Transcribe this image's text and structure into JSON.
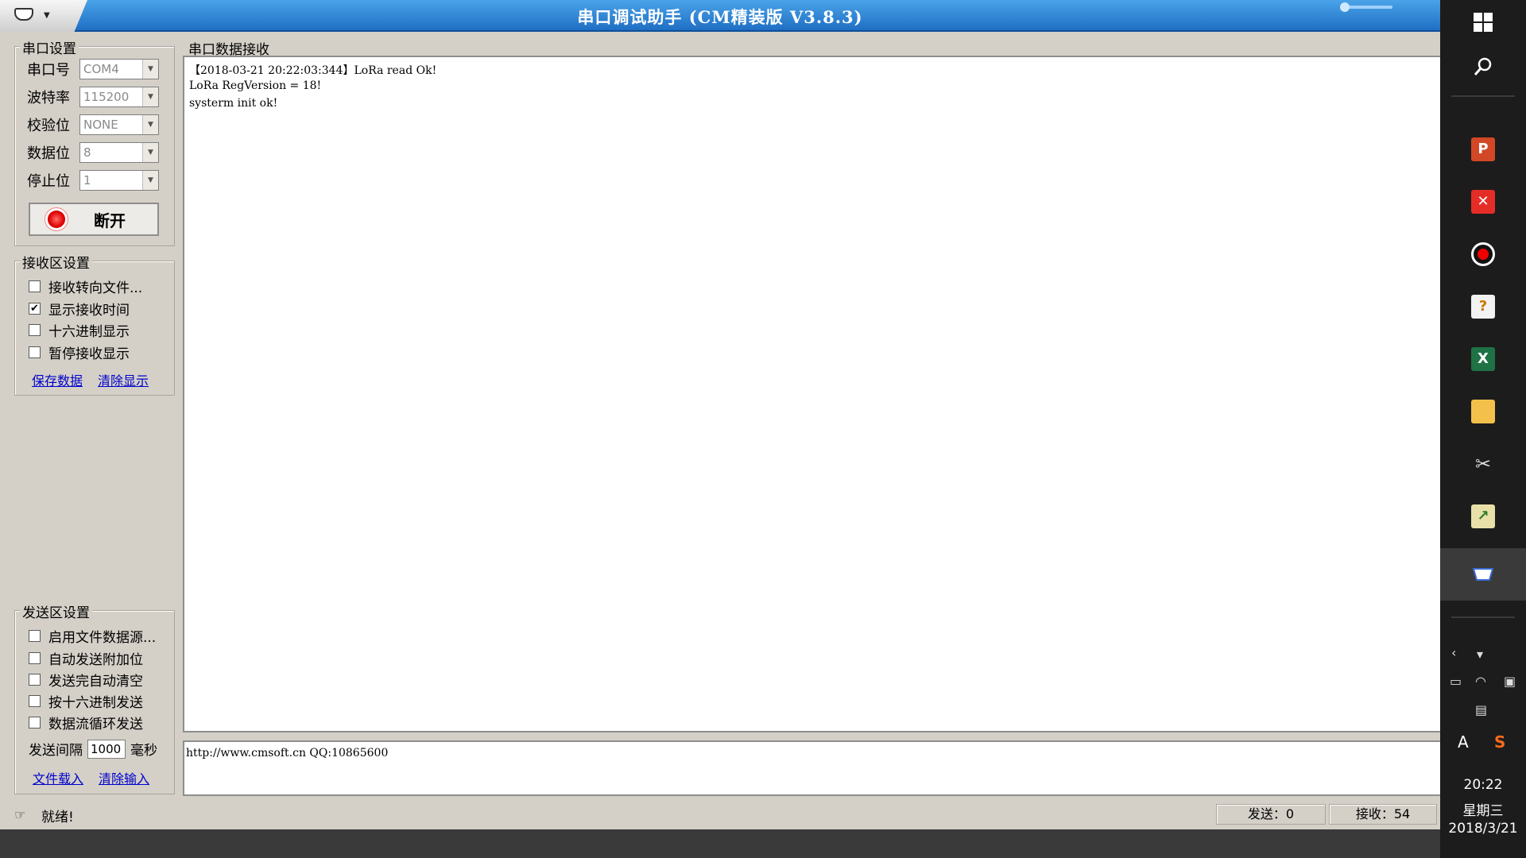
{
  "window": {
    "title": "串口调试助手 (CM精装版 V3.8.3)"
  },
  "serial_settings": {
    "group_title": "串口设置",
    "fields": [
      {
        "label": "串口号",
        "value": "COM4"
      },
      {
        "label": "波特率",
        "value": "115200"
      },
      {
        "label": "校验位",
        "value": "NONE"
      },
      {
        "label": "数据位",
        "value": "8"
      },
      {
        "label": "停止位",
        "value": "1"
      }
    ],
    "toggle_button": "断开"
  },
  "receive_settings": {
    "group_title": "接收区设置",
    "options": [
      {
        "label": "接收转向文件...",
        "checked": false
      },
      {
        "label": "显示接收时间",
        "checked": true
      },
      {
        "label": "十六进制显示",
        "checked": false
      },
      {
        "label": "暂停接收显示",
        "checked": false
      }
    ],
    "save_link": "保存数据",
    "clear_link": "清除显示"
  },
  "receive_area": {
    "title": "串口数据接收",
    "lines": [
      "【2018-03-21 20:22:03:344】LoRa read Ok!",
      "LoRa RegVersion = 18!",
      "systerm init ok!"
    ]
  },
  "send_settings": {
    "group_title": "发送区设置",
    "options": [
      {
        "label": "启用文件数据源...",
        "checked": false
      },
      {
        "label": "自动发送附加位",
        "checked": false
      },
      {
        "label": "发送完自动清空",
        "checked": false
      },
      {
        "label": "按十六进制发送",
        "checked": false
      },
      {
        "label": "数据流循环发送",
        "checked": false
      }
    ],
    "interval_label": "发送间隔",
    "interval_value": "1000",
    "interval_unit": "毫秒",
    "load_link": "文件载入",
    "clear_link": "清除输入"
  },
  "send_area": {
    "text": "http://www.cmsoft.cn QQ:10865600"
  },
  "status_bar": {
    "text": "就绪!",
    "sent": "发送：0",
    "received": "接收：54"
  },
  "taskbar": {
    "clock_time": "20:22",
    "clock_day": "星期三",
    "clock_date": "2018/3/21",
    "ime_label": "A"
  },
  "colors": {
    "title_bar": "#1f6fc4",
    "window_bg": "#d4d0c8",
    "taskbar_bg": "#1c1c1c",
    "link": "#0000cc"
  }
}
